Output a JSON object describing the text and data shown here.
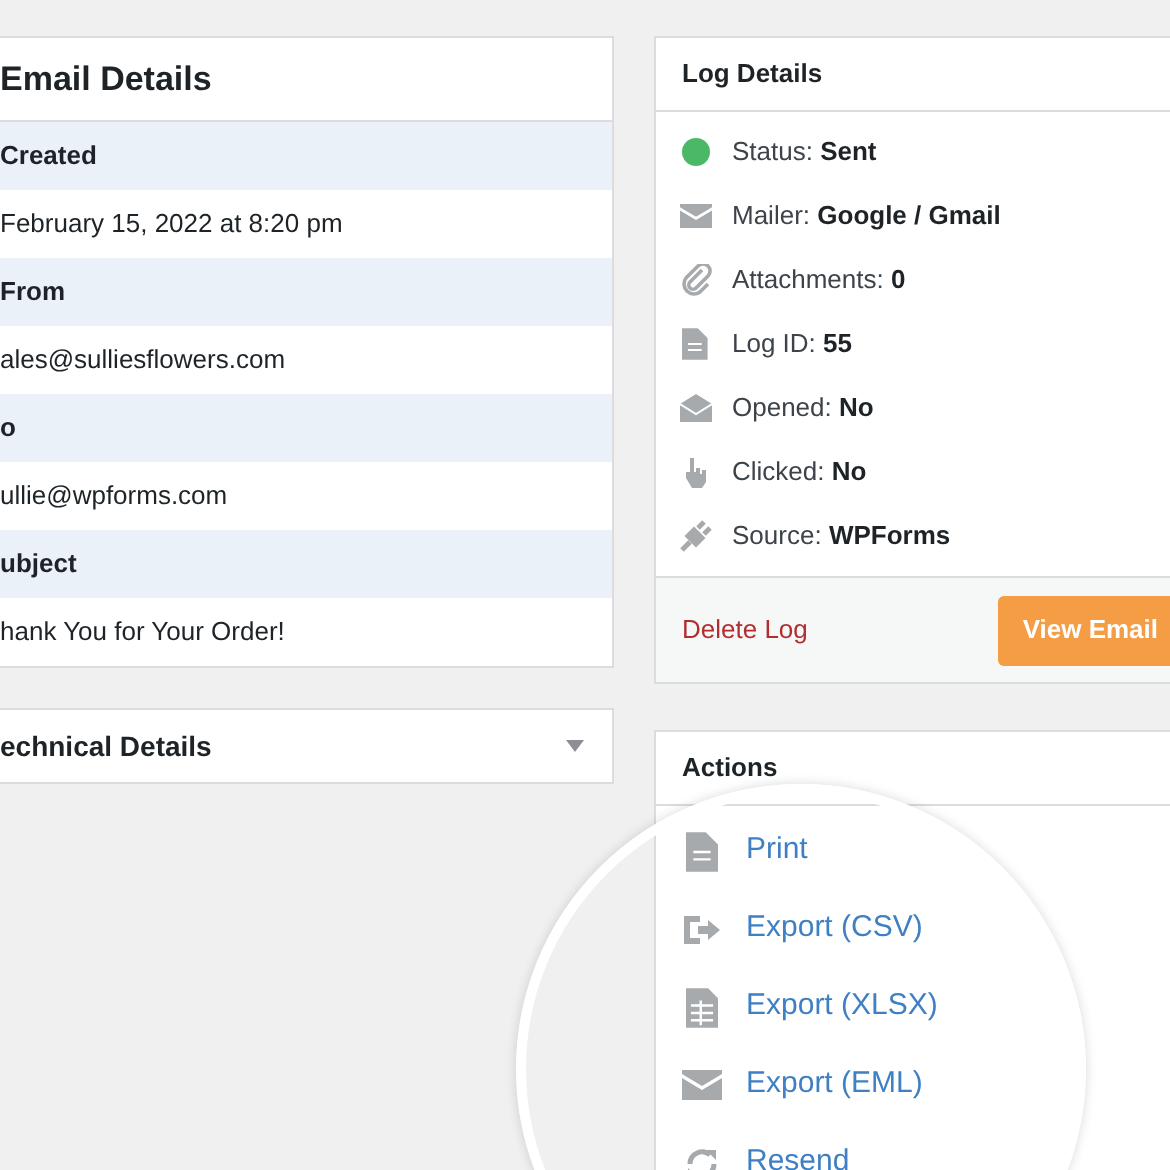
{
  "email_details": {
    "title": "Email Details",
    "fields": [
      {
        "label": "Created",
        "value": "February 15, 2022 at 8:20 pm"
      },
      {
        "label": "From",
        "value": "ales@sulliesflowers.com"
      },
      {
        "label": "o",
        "value": "ullie@wpforms.com"
      },
      {
        "label": "ubject",
        "value": "hank You for Your Order!"
      }
    ]
  },
  "technical_details": {
    "title": "echnical Details",
    "expanded": false
  },
  "log_details": {
    "title": "Log Details",
    "items": [
      {
        "kind": "status",
        "label": "Status:",
        "value": "Sent",
        "color": "#4ab866"
      },
      {
        "kind": "mailer",
        "label": "Mailer:",
        "value": "Google / Gmail"
      },
      {
        "kind": "attachments",
        "label": "Attachments:",
        "value": "0"
      },
      {
        "kind": "log_id",
        "label": "Log ID:",
        "value": "55"
      },
      {
        "kind": "opened",
        "label": "Opened:",
        "value": "No"
      },
      {
        "kind": "clicked",
        "label": "Clicked:",
        "value": "No"
      },
      {
        "kind": "source",
        "label": "Source:",
        "value": "WPForms"
      }
    ],
    "delete_link": "Delete Log",
    "view_button": "View Email"
  },
  "actions": {
    "title": "Actions",
    "items": [
      {
        "kind": "print",
        "label": "Print"
      },
      {
        "kind": "csv",
        "label": "Export (CSV)"
      },
      {
        "kind": "xlsx",
        "label": "Export (XLSX)"
      },
      {
        "kind": "eml",
        "label": "Export (EML)"
      },
      {
        "kind": "resend",
        "label": "Resend"
      }
    ]
  }
}
